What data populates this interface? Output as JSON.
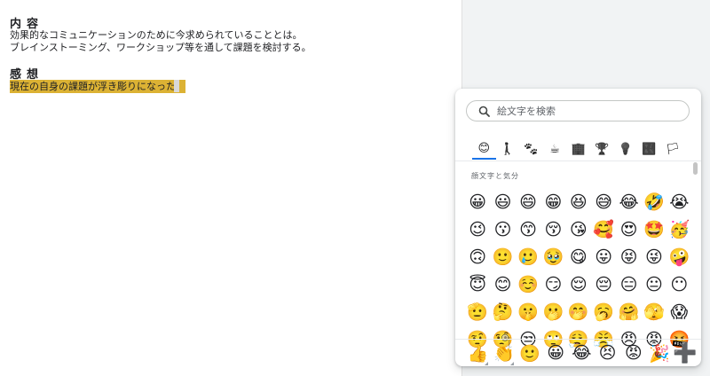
{
  "document": {
    "heading1": "内容",
    "body1_line1": "効果的なコミュニケーションのために今求められていることとは。",
    "body1_line2": "ブレインストーミング、ワークショップ等を通して課題を検討する。",
    "heading2": "感想",
    "body2_line1": "現在の自身の課題が浮き彫りになった。"
  },
  "picker": {
    "search_placeholder": "絵文字を検索",
    "categories": [
      {
        "name": "smileys",
        "glyph": "😊"
      },
      {
        "name": "people",
        "glyph": "🚶"
      },
      {
        "name": "animals-nature",
        "glyph": "🐾"
      },
      {
        "name": "food-drink",
        "glyph": "☕"
      },
      {
        "name": "travel-places",
        "glyph": "🏢"
      },
      {
        "name": "activities",
        "glyph": "🏆"
      },
      {
        "name": "objects",
        "glyph": "💡"
      },
      {
        "name": "symbols",
        "glyph": "🔣"
      },
      {
        "name": "flags",
        "glyph": "🏳"
      }
    ],
    "section_title": "顔文字と気分",
    "emoji_rows": [
      [
        "😀",
        "😃",
        "😄",
        "😁",
        "😆",
        "😅",
        "😂",
        "🤣",
        "😭"
      ],
      [
        "😉",
        "😗",
        "😙",
        "😚",
        "😘",
        "🥰",
        "😍",
        "🤩",
        "🥳"
      ],
      [
        "🙃",
        "🙂",
        "🥲",
        "🥹",
        "😋",
        "😛",
        "😝",
        "😜",
        "🤪"
      ],
      [
        "😇",
        "😊",
        "☺️",
        "😏",
        "😌",
        "😔",
        "😑",
        "😐",
        "😶"
      ],
      [
        "🫡",
        "🤔",
        "🤫",
        "🫢",
        "🤭",
        "🥱",
        "🤗",
        "🫣",
        "😱"
      ],
      [
        "🤨",
        "🧐",
        "😒",
        "🙄",
        "😮‍💨",
        "😤",
        "😠",
        "😡",
        "🤬"
      ]
    ],
    "bottom_row": [
      "👍",
      "👏",
      "🙂",
      "😀",
      "😂",
      "😣",
      "😡",
      "🎉"
    ],
    "add_glyph": "➕"
  }
}
